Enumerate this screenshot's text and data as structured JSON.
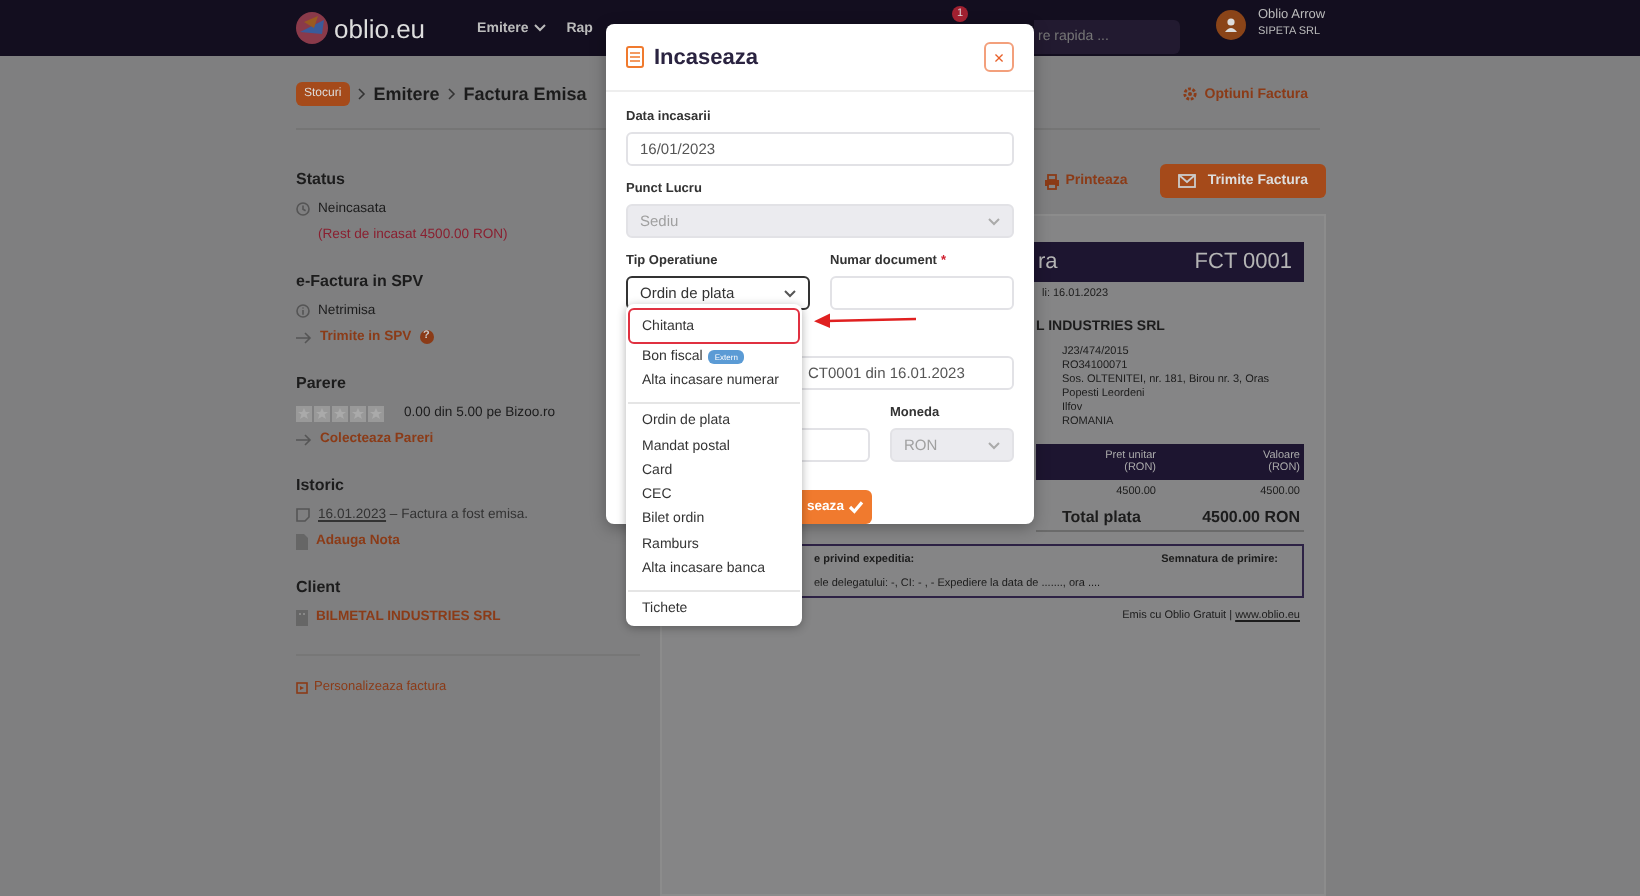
{
  "header": {
    "logo": "oblio.eu",
    "nav": [
      {
        "label": "Emitere",
        "dropdown": true
      },
      {
        "label": "Rap",
        "dropdown": false
      }
    ],
    "notification_count": "1",
    "search": {
      "placeholder": "re rapida ..."
    },
    "user": {
      "name": "Oblio Arrow",
      "company": "SIPETA SRL"
    }
  },
  "breadcrumb": [
    "Stocuri",
    "Emitere",
    "Factura Emisa"
  ],
  "invoice_options": "Optiuni Factura",
  "sidebar": [
    {
      "title": "Status",
      "items": [
        {
          "kind": "pending",
          "text": "Neincasata"
        },
        {
          "kind": "note",
          "text": "(Rest de incasat 4500.00 RON)"
        }
      ]
    },
    {
      "title": "e-Factura in SPV",
      "items": [
        {
          "kind": "info",
          "text": "Netrimisa"
        },
        {
          "kind": "help-link",
          "text": "Trimite in SPV",
          "help": "?"
        }
      ]
    },
    {
      "title": "Parere",
      "items": [
        {
          "kind": "rating",
          "stars": 0,
          "text": "0.00 din 5.00 pe Bizoo.ro"
        },
        {
          "kind": "link",
          "text": "Colecteaza Pareri"
        }
      ]
    },
    {
      "title": "Istoric",
      "items": [
        {
          "kind": "history",
          "date": "16.01.2023",
          "text": " – Factura a fost emisa."
        },
        {
          "kind": "add-note",
          "text": "Adauga Nota"
        }
      ]
    },
    {
      "title": "Client",
      "items": [
        {
          "kind": "client",
          "text": "BILMETAL INDUSTRIES SRL"
        }
      ]
    }
  ],
  "customize": "Personalizeaza factura",
  "actions": {
    "print": "Printeaza",
    "send": "Trimite Factura"
  },
  "invoice": {
    "title": "ra",
    "number": "FCT 0001",
    "date": "li: 16.01.2023",
    "client_name": "L INDUSTRIES SRL",
    "client_details": [
      "J23/474/2015",
      "RO34100071",
      "Sos. OLTENITEI, nr. 181, Birou nr. 3, Oras",
      "Popesti Leordeni",
      "Ilfov",
      "ROMANIA"
    ],
    "columns": [
      {
        "label": "Pret unitar",
        "unit": "(RON)"
      },
      {
        "label": "Valoare",
        "unit": "(RON)"
      }
    ],
    "row": [
      "4500.00",
      "4500.00"
    ],
    "total_label": "Total plata",
    "total_value": "4500.00 RON",
    "shipping": {
      "title": "e privind expeditia:",
      "text": "ele delegatului: -, CI: - , - Expediere la data de ......., ora ....",
      "signature": "Semnatura de primire:"
    },
    "footer": {
      "text": "Emis cu Oblio Gratuit |",
      "link": "www.oblio.eu"
    }
  },
  "modal": {
    "title": "Incaseaza",
    "close": "×",
    "fields": [
      {
        "kind": "input",
        "label": "Data incasarii",
        "value": "16/01/2023",
        "disabled": false,
        "focused": false
      },
      {
        "kind": "select",
        "label": "Punct Lucru",
        "value": "Sediu",
        "disabled": true,
        "focused": false
      },
      {
        "kind": "select",
        "label": "Tip Operatiune",
        "value": "Ordin de plata",
        "disabled": false,
        "focused": true
      },
      {
        "kind": "input",
        "label": "Numar document",
        "required_mark": "*",
        "disabled": false,
        "focused": false
      },
      {
        "kind": "input",
        "value": "CT0001 din 16.01.2023",
        "disabled": false,
        "focused": false
      },
      {
        "kind": "input",
        "disabled": false,
        "focused": false
      },
      {
        "kind": "select",
        "label": "Moneda",
        "value": "RON",
        "disabled": true,
        "focused": false
      }
    ],
    "submit": "seaza"
  },
  "dropdown": [
    [
      {
        "label": "Chitanta",
        "selected": true
      },
      {
        "label": "Bon fiscal",
        "badge": "Extern",
        "selected": false
      },
      {
        "label": "Alta incasare numerar",
        "selected": false
      }
    ],
    [
      {
        "label": "Ordin de plata",
        "selected": false
      },
      {
        "label": "Mandat postal",
        "selected": false
      },
      {
        "label": "Card",
        "selected": false
      },
      {
        "label": "CEC",
        "selected": false
      },
      {
        "label": "Bilet ordin",
        "selected": false
      },
      {
        "label": "Ramburs",
        "selected": false
      },
      {
        "label": "Alta incasare banca",
        "selected": false
      }
    ],
    [
      {
        "label": "Tichete",
        "selected": false
      }
    ]
  ]
}
